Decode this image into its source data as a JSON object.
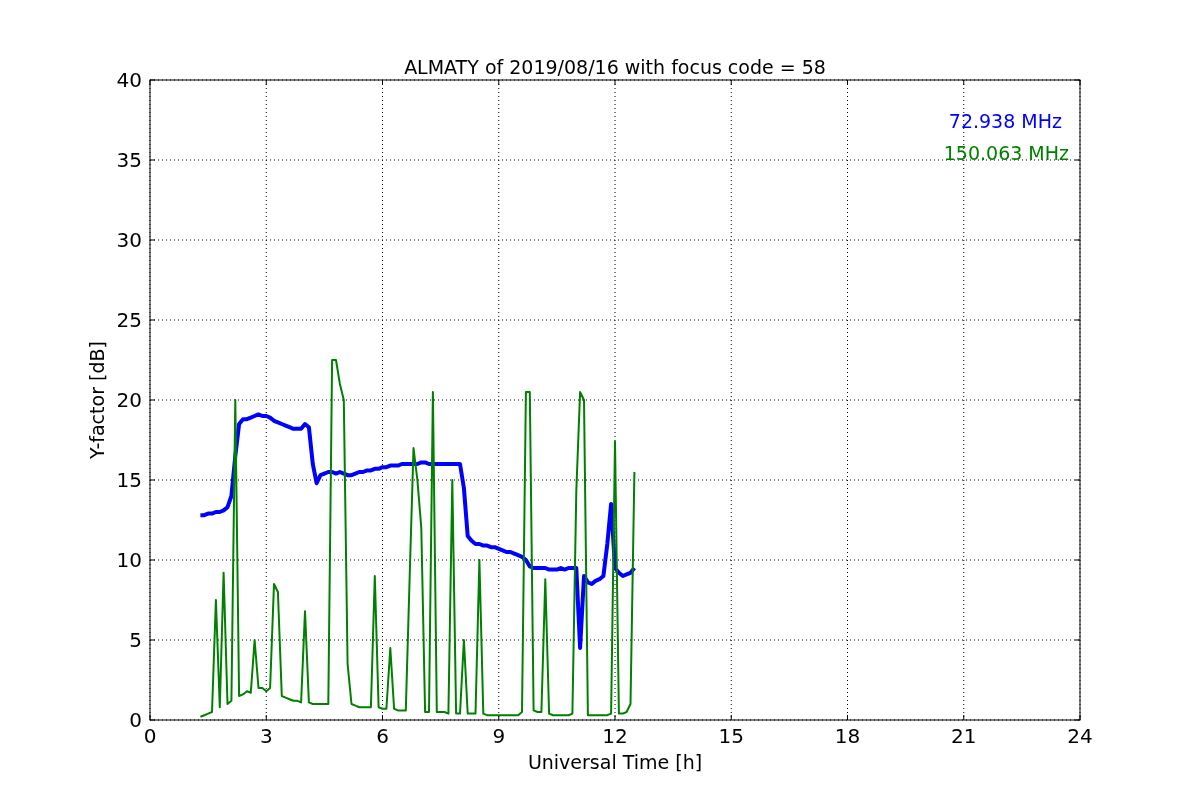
{
  "figure": {
    "chart_data": {
      "type": "line",
      "title": "ALMATY of 2019/08/16 with focus code = 58",
      "xlabel": "Universal Time [h]",
      "ylabel": "Y-factor [dB]",
      "xlim": [
        0,
        24
      ],
      "ylim": [
        0,
        40
      ],
      "xticks": [
        0,
        3,
        6,
        9,
        12,
        15,
        18,
        21,
        24
      ],
      "yticks": [
        0,
        5,
        10,
        15,
        20,
        25,
        30,
        35,
        40
      ],
      "grid": true,
      "x": [
        1.3,
        1.4,
        1.5,
        1.6,
        1.7,
        1.8,
        1.9,
        2.0,
        2.1,
        2.2,
        2.3,
        2.4,
        2.5,
        2.6,
        2.7,
        2.8,
        2.9,
        3.0,
        3.1,
        3.2,
        3.3,
        3.4,
        3.5,
        3.6,
        3.7,
        3.8,
        3.9,
        4.0,
        4.1,
        4.2,
        4.3,
        4.4,
        4.5,
        4.6,
        4.7,
        4.8,
        4.9,
        5.0,
        5.1,
        5.2,
        5.3,
        5.4,
        5.5,
        5.6,
        5.7,
        5.8,
        5.9,
        6.0,
        6.1,
        6.2,
        6.3,
        6.4,
        6.5,
        6.6,
        6.7,
        6.8,
        6.9,
        7.0,
        7.1,
        7.2,
        7.3,
        7.4,
        7.5,
        7.6,
        7.7,
        7.8,
        7.9,
        8.0,
        8.1,
        8.2,
        8.3,
        8.4,
        8.5,
        8.6,
        8.7,
        8.8,
        8.9,
        9.0,
        9.1,
        9.2,
        9.3,
        9.4,
        9.5,
        9.6,
        9.7,
        9.8,
        9.9,
        10.0,
        10.1,
        10.2,
        10.3,
        10.4,
        10.5,
        10.6,
        10.7,
        10.8,
        10.9,
        11.0,
        11.1,
        11.2,
        11.3,
        11.4,
        11.5,
        11.6,
        11.7,
        11.8,
        11.9,
        12.0,
        12.1,
        12.2,
        12.3,
        12.4,
        12.5
      ],
      "series": [
        {
          "name": "72.938 MHz",
          "color": "#0000ff",
          "values": [
            12.8,
            12.8,
            12.9,
            12.9,
            13,
            13,
            13.1,
            13.3,
            14,
            16.5,
            18.5,
            18.8,
            18.8,
            18.9,
            19,
            19.1,
            19,
            19,
            18.9,
            18.7,
            18.6,
            18.5,
            18.4,
            18.3,
            18.2,
            18.2,
            18.2,
            18.5,
            18.3,
            16,
            14.8,
            15.3,
            15.4,
            15.5,
            15.5,
            15.4,
            15.5,
            15.4,
            15.3,
            15.3,
            15.4,
            15.5,
            15.5,
            15.6,
            15.6,
            15.7,
            15.7,
            15.8,
            15.8,
            15.9,
            15.9,
            15.9,
            16,
            16,
            16,
            16,
            16,
            16.1,
            16.1,
            16,
            16,
            16,
            16,
            16,
            16,
            16,
            16,
            16,
            14.5,
            11.5,
            11.2,
            11,
            11,
            10.9,
            10.9,
            10.8,
            10.8,
            10.7,
            10.6,
            10.5,
            10.5,
            10.4,
            10.3,
            10.2,
            10,
            9.6,
            9.5,
            9.5,
            9.5,
            9.5,
            9.4,
            9.4,
            9.4,
            9.5,
            9.4,
            9.5,
            9.5,
            9.5,
            4.5,
            9,
            8.6,
            8.5,
            8.7,
            8.8,
            9,
            11,
            13.5,
            9.5,
            9.2,
            9,
            9.1,
            9.2,
            9.5
          ]
        },
        {
          "name": "150.063 MHz",
          "color": "#008000",
          "values": [
            0.2,
            0.3,
            0.4,
            0.5,
            7.5,
            0.8,
            9.2,
            1,
            1.2,
            20,
            1.5,
            1.6,
            1.8,
            1.7,
            5,
            2,
            2,
            1.8,
            2,
            8.5,
            8,
            1.5,
            1.4,
            1.3,
            1.2,
            1.2,
            1.1,
            6.8,
            1.1,
            1,
            1,
            1,
            1,
            1,
            22.5,
            22.5,
            21,
            20,
            3.5,
            1,
            0.9,
            0.8,
            0.8,
            0.8,
            0.8,
            9,
            0.8,
            0.7,
            0.7,
            4.5,
            0.7,
            0.6,
            0.6,
            0.6,
            8.8,
            17,
            15,
            12,
            0.5,
            0.5,
            20.5,
            0.5,
            0.5,
            0.5,
            0.4,
            15,
            0.4,
            0.4,
            5,
            0.4,
            0.4,
            0.4,
            10,
            0.4,
            0.3,
            0.3,
            0.3,
            0.3,
            0.3,
            0.3,
            0.3,
            0.3,
            0.3,
            0.5,
            20.5,
            20.5,
            0.6,
            0.5,
            0.5,
            8.8,
            0.4,
            0.3,
            0.3,
            0.3,
            0.3,
            0.3,
            0.4,
            14.3,
            20.5,
            20,
            0.3,
            0.3,
            0.3,
            0.3,
            0.3,
            0.3,
            0.4,
            17.4,
            0.4,
            0.4,
            0.5,
            1,
            15.5
          ]
        }
      ]
    }
  }
}
